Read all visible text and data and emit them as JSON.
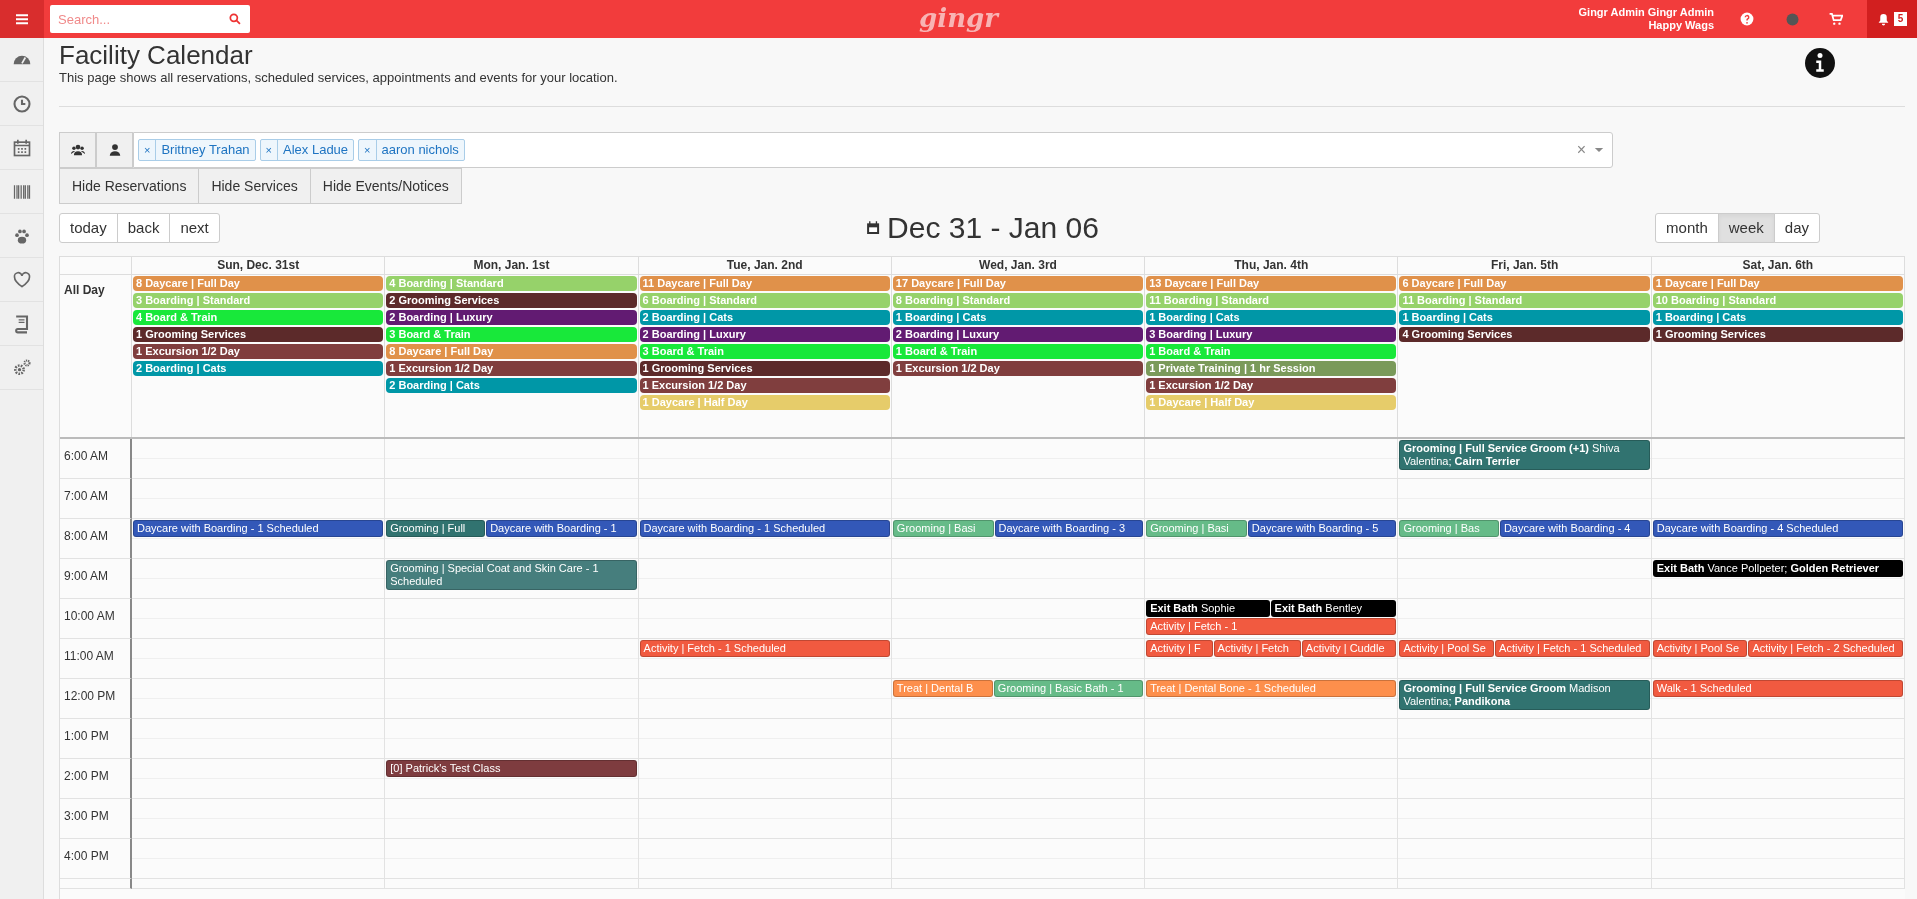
{
  "top_bar": {
    "search": {
      "placeholder": "Search..."
    },
    "logo": "gingr",
    "user": {
      "name": "Gingr Admin Gingr Admin",
      "location": "Happy Wags"
    },
    "notifications": "5"
  },
  "page": {
    "title": "Facility Calendar",
    "description": "This page shows all reservations, scheduled services, appointments and events for your location."
  },
  "filter": {
    "tags": [
      {
        "label": "Brittney Trahan",
        "remove": "×"
      },
      {
        "label": "Alex Ladue",
        "remove": "×"
      },
      {
        "label": "aaron nichols",
        "remove": "×"
      }
    ],
    "clear": "×"
  },
  "toggle_buttons": [
    "Hide Reservations",
    "Hide Services",
    "Hide Events/Notices"
  ],
  "nav_buttons": [
    "today",
    "back",
    "next"
  ],
  "range_title": "Dec 31 - Jan 06",
  "views": [
    {
      "label": "month",
      "selected": false
    },
    {
      "label": "week",
      "selected": true
    },
    {
      "label": "day",
      "selected": false
    }
  ],
  "calendar": {
    "all_day_label": "All Day",
    "days": [
      {
        "header": "Sun, Dec. 31st",
        "all_day": [
          {
            "label": "8 Daycare | Full Day",
            "color": "#e0914a"
          },
          {
            "label": "3 Boarding | Standard",
            "color": "#96d26a"
          },
          {
            "label": "4 Board & Train",
            "color": "#18e83a"
          },
          {
            "label": "1 Grooming Services",
            "color": "#5c2a2a"
          },
          {
            "label": "1 Excursion 1/2 Day",
            "color": "#803e3e"
          },
          {
            "label": "2 Boarding | Cats",
            "color": "#0097a7"
          }
        ]
      },
      {
        "header": "Mon, Jan. 1st",
        "all_day": [
          {
            "label": "4 Boarding | Standard",
            "color": "#96d26a"
          },
          {
            "label": "2 Grooming Services",
            "color": "#5c2a2a"
          },
          {
            "label": "2 Boarding | Luxury",
            "color": "#621b72"
          },
          {
            "label": "3 Board & Train",
            "color": "#18e83a"
          },
          {
            "label": "8 Daycare | Full Day",
            "color": "#e0914a"
          },
          {
            "label": "1 Excursion 1/2 Day",
            "color": "#803e3e"
          },
          {
            "label": "2 Boarding | Cats",
            "color": "#0097a7"
          }
        ]
      },
      {
        "header": "Tue, Jan. 2nd",
        "all_day": [
          {
            "label": "11 Daycare | Full Day",
            "color": "#e0914a"
          },
          {
            "label": "6 Boarding | Standard",
            "color": "#96d26a"
          },
          {
            "label": "2 Boarding | Cats",
            "color": "#0097a7"
          },
          {
            "label": "2 Boarding | Luxury",
            "color": "#621b72"
          },
          {
            "label": "3 Board & Train",
            "color": "#18e83a"
          },
          {
            "label": "1 Grooming Services",
            "color": "#5c2a2a"
          },
          {
            "label": "1 Excursion 1/2 Day",
            "color": "#803e3e"
          },
          {
            "label": "1 Daycare | Half Day",
            "color": "#e6cc6a"
          }
        ]
      },
      {
        "header": "Wed, Jan. 3rd",
        "all_day": [
          {
            "label": "17 Daycare | Full Day",
            "color": "#e0914a"
          },
          {
            "label": "8 Boarding | Standard",
            "color": "#96d26a"
          },
          {
            "label": "1 Boarding | Cats",
            "color": "#0097a7"
          },
          {
            "label": "2 Boarding | Luxury",
            "color": "#621b72"
          },
          {
            "label": "1 Board & Train",
            "color": "#18e83a"
          },
          {
            "label": "1 Excursion 1/2 Day",
            "color": "#803e3e"
          }
        ]
      },
      {
        "header": "Thu, Jan. 4th",
        "all_day": [
          {
            "label": "13 Daycare | Full Day",
            "color": "#e0914a"
          },
          {
            "label": "11 Boarding | Standard",
            "color": "#96d26a"
          },
          {
            "label": "1 Boarding | Cats",
            "color": "#0097a7"
          },
          {
            "label": "3 Boarding | Luxury",
            "color": "#621b72"
          },
          {
            "label": "1 Board & Train",
            "color": "#18e83a"
          },
          {
            "label": "1 Private Training | 1 hr Session",
            "color": "#7a9a5a"
          },
          {
            "label": "1 Excursion 1/2 Day",
            "color": "#803e3e"
          },
          {
            "label": "1 Daycare | Half Day",
            "color": "#e6cc6a"
          }
        ]
      },
      {
        "header": "Fri, Jan. 5th",
        "all_day": [
          {
            "label": "6 Daycare | Full Day",
            "color": "#e0914a"
          },
          {
            "label": "11 Boarding | Standard",
            "color": "#96d26a"
          },
          {
            "label": "1 Boarding | Cats",
            "color": "#0097a7"
          },
          {
            "label": "4 Grooming Services",
            "color": "#5c2a2a"
          }
        ]
      },
      {
        "header": "Sat, Jan. 6th",
        "all_day": [
          {
            "label": "1 Daycare | Full Day",
            "color": "#e0914a"
          },
          {
            "label": "10 Boarding | Standard",
            "color": "#96d26a"
          },
          {
            "label": "1 Boarding | Cats",
            "color": "#0097a7"
          },
          {
            "label": "1 Grooming Services",
            "color": "#5c2a2a"
          }
        ]
      }
    ],
    "hours": [
      {
        "label": "6:00 AM",
        "cells": [
          {},
          {},
          {},
          {},
          {},
          {
            "events": [
              {
                "label": "**Grooming | Full Service Groom (+1)** Shiva Valentina; **Cairn Terrier**",
                "color": "#317370"
              }
            ]
          },
          {}
        ]
      },
      {
        "label": "7:00 AM"
      },
      {
        "label": "8:00 AM",
        "cells": [
          {
            "events": [
              {
                "label": "Daycare with Boarding - 1 Scheduled",
                "color": "#3358b8"
              }
            ]
          },
          {
            "events": [
              {
                "label": "Grooming | Full",
                "color": "#317370"
              },
              {
                "label": "Daycare with Boarding - 1",
                "color": "#3358b8"
              }
            ]
          },
          {
            "events": [
              {
                "label": "Daycare with Boarding - 1 Scheduled",
                "color": "#3358b8"
              }
            ]
          },
          {
            "events": [
              {
                "label": "Grooming | Basi",
                "color": "#66bb88"
              },
              {
                "label": "Daycare with Boarding - 3",
                "color": "#3358b8"
              }
            ]
          },
          {
            "events": [
              {
                "label": "Grooming | Basi",
                "color": "#66bb88"
              },
              {
                "label": "Daycare with Boarding - 5",
                "color": "#3358b8"
              }
            ]
          },
          {
            "events": [
              {
                "label": "Grooming | Bas",
                "color": "#66bb88"
              },
              {
                "label": "Daycare with Boarding - 4",
                "color": "#3358b8"
              }
            ]
          },
          {
            "events": [
              {
                "label": "Daycare with Boarding - 4 Scheduled",
                "color": "#3358b8"
              }
            ]
          }
        ]
      },
      {
        "label": "9:00 AM",
        "cells": [
          {},
          {
            "events": [
              {
                "label": "Grooming | Special Coat and Skin Care - 1 Scheduled",
                "color": "#467e7d"
              }
            ]
          },
          {},
          {},
          {},
          {},
          {
            "events": [
              {
                "label": "**Exit Bath** Vance Pollpeter; **Golden Retriever**",
                "color": "#000000"
              }
            ]
          }
        ]
      },
      {
        "label": "10:00 AM",
        "cells": [
          {},
          {},
          {},
          {},
          {
            "events": [
              {
                "label": "**Exit Bath** Sophie",
                "color": "#000000"
              },
              {
                "label": "**Exit Bath** Bentley",
                "color": "#000000"
              },
              {
                "label": "Activity | Fetch - 1",
                "color": "#f15a40"
              }
            ]
          },
          {},
          {}
        ]
      },
      {
        "label": "11:00 AM",
        "cells": [
          {},
          {},
          {
            "events": [
              {
                "label": "Activity | Fetch - 1 Scheduled",
                "color": "#f15a40"
              }
            ]
          },
          {},
          {
            "events": [
              {
                "label": "Activity | F",
                "color": "#f15a40"
              },
              {
                "label": "Activity | Fetch",
                "color": "#f15a40"
              },
              {
                "label": "Activity | Cuddle",
                "color": "#f15a40"
              }
            ]
          },
          {
            "events": [
              {
                "label": "Activity | Pool Se",
                "color": "#f15a40"
              },
              {
                "label": "Activity | Fetch - 1 Scheduled",
                "color": "#f15a40"
              }
            ]
          },
          {
            "events": [
              {
                "label": "Activity | Pool Se",
                "color": "#f15a40"
              },
              {
                "label": "Activity | Fetch - 2 Scheduled",
                "color": "#f15a40"
              }
            ]
          }
        ]
      },
      {
        "label": "12:00 PM",
        "cells": [
          {},
          {},
          {},
          {
            "events": [
              {
                "label": "Treat | Dental B",
                "color": "#fd8f4c"
              },
              {
                "label": "Grooming | Basic Bath - 1",
                "color": "#66bb88"
              }
            ]
          },
          {
            "events": [
              {
                "label": "Treat | Dental Bone - 1 Scheduled",
                "color": "#fd8f4c"
              }
            ]
          },
          {
            "events": [
              {
                "label": "**Grooming | Full Service Groom** Madison Valentina; **Pandikona**",
                "color": "#317370"
              }
            ]
          },
          {
            "events": [
              {
                "label": "Walk - 1 Scheduled",
                "color": "#f15a40"
              }
            ]
          }
        ]
      },
      {
        "label": "1:00 PM"
      },
      {
        "label": "2:00 PM",
        "cells": [
          {},
          {
            "events": [
              {
                "label": "[0] Patrick's Test Class",
                "color": "#7e3c3f"
              }
            ]
          },
          {},
          {},
          {},
          {},
          {}
        ]
      },
      {
        "label": "3:00 PM"
      },
      {
        "label": "4:00 PM"
      }
    ]
  }
}
